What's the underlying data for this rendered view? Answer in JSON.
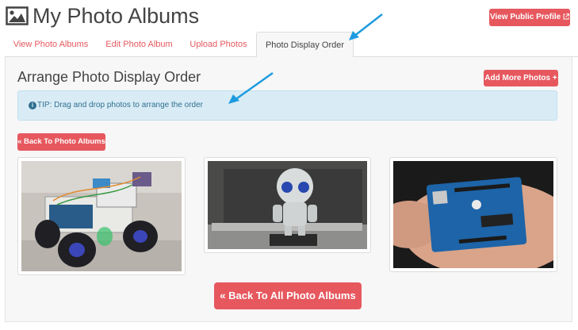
{
  "header": {
    "title": "My Photo Albums",
    "public_profile_label": "View Public Profile"
  },
  "tabs": [
    {
      "label": "View Photo Albums"
    },
    {
      "label": "Edit Photo Album"
    },
    {
      "label": "Upload Photos"
    },
    {
      "label": "Photo Display Order",
      "active": true
    }
  ],
  "section": {
    "title": "Arrange Photo Display Order",
    "add_more_label": "Add More Photos +"
  },
  "tip": {
    "text": "TIP: Drag and drop photos to arrange the order"
  },
  "buttons": {
    "back_small": "« Back To Photo Albums",
    "back_big": "« Back To All Photo Albums"
  },
  "photos": [
    {
      "subject": "robot car with blue wheels and breadboard"
    },
    {
      "subject": "small robot figure in front of laptop"
    },
    {
      "subject": "hand holding Arduino Uno board"
    }
  ],
  "colors": {
    "accent": "#e6585e",
    "tip_bg": "#d9ecf6",
    "tip_text": "#31708f",
    "annotation_arrow": "#1e9be0"
  }
}
